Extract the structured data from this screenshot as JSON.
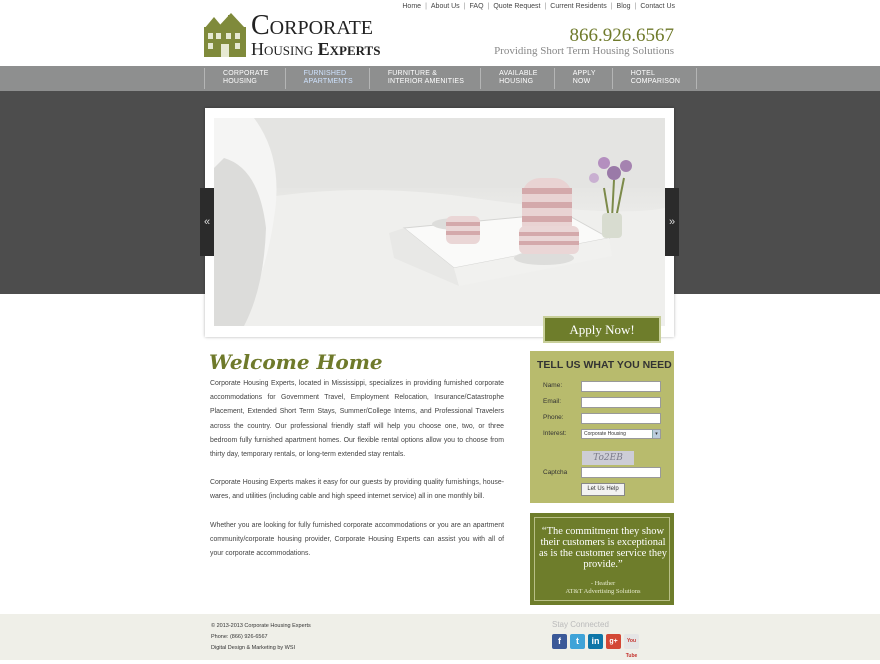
{
  "header": {
    "logo_line1": "Corporate",
    "logo_line2a": "Housing",
    "logo_line2b": "Experts",
    "top_links": [
      "Home",
      "About Us",
      "FAQ",
      "Quote Request",
      "Current Residents",
      "Blog",
      "Contact Us"
    ],
    "phone": "866.926.6567",
    "tagline": "Providing Short Term Housing Solutions"
  },
  "nav": {
    "items": [
      {
        "line1": "Corporate",
        "line2": "Housing"
      },
      {
        "line1": "Furnished",
        "line2": "Apartments"
      },
      {
        "line1": "Furniture &",
        "line2": "Interior Amenities"
      },
      {
        "line1": "Available",
        "line2": "Housing"
      },
      {
        "line1": "Apply",
        "line2": "Now"
      },
      {
        "line1": "Hotel",
        "line2": "Comparison"
      }
    ],
    "active_index": 1
  },
  "slider": {
    "prev": "«",
    "next": "»",
    "apply_label": "Apply Now!"
  },
  "content": {
    "heading": "Welcome Home",
    "paragraph1": "Corporate Housing Experts, located in Mississippi, specializes in providing furnished corporate accommodations for Government Travel, Employment Relocation, Insurance/Catastrophe Placement, Extended Short Term Stays, Summer/College Interns, and Professional Travelers across the country. Our professional friendly staff will help you choose one, two, or three bedroom fully furnished apartment homes. Our flexible rental options allow you to choose from thirty day, temporary rentals, or long-term extended stay rentals.",
    "paragraph2": "Corporate Housing Experts makes it easy for our guests by providing quality furnishings, house-wares, and utilities (including cable and high speed internet service) all in one monthly bill.",
    "paragraph3": "Whether you are looking for fully furnished corporate accommodations or you are an apartment community/corporate housing provider, Corporate Housing Experts can assist you with all of your corporate accommodations."
  },
  "form": {
    "title": "TELL US WHAT YOU NEED",
    "name_label": "Name:",
    "email_label": "Email:",
    "phone_label": "Phone:",
    "interest_label": "Interest:",
    "interest_value": "Corporate Housing",
    "captcha_text": "To2EB",
    "captcha_label": "Captcha",
    "submit_label": "Let Us Help"
  },
  "testimonial": {
    "quote": "“The commitment they show their customers is exceptional as is the customer service they provide.”",
    "author": "- Heather",
    "company": "AT&T Advertising Solutions"
  },
  "footer": {
    "copyright": "© 2013-2013 Corporate Housing Experts",
    "phone": "Phone: (866) 926-6567",
    "credit": "Digital Design & Marketing by WSI",
    "stay_connected": "Stay Connected",
    "social": {
      "facebook": "f",
      "twitter": "t",
      "linkedin": "in",
      "googleplus": "g+",
      "youtube": "You Tube"
    }
  },
  "colors": {
    "brand_green": "#6e7d2b",
    "form_bg": "#b8bb6d",
    "nav_bg": "#8e8f8f",
    "band_bg": "#4d4d4d"
  }
}
